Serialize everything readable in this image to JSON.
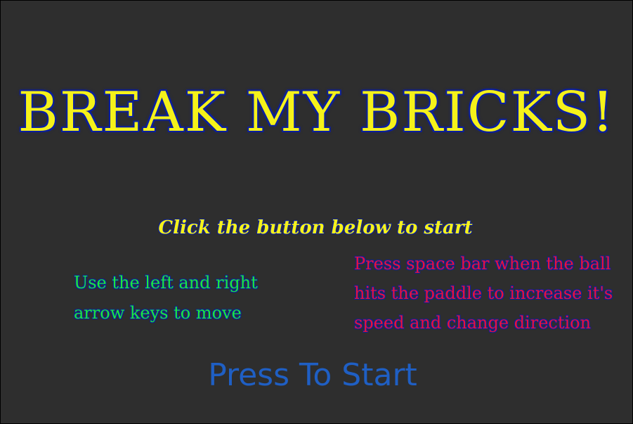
{
  "game": {
    "title": "Break My Bricks!",
    "subtitle": "Click the button below to start",
    "instructions_left": [
      "Use the left and right",
      "arrow keys to move"
    ],
    "instructions_right": [
      "Press space bar when the ball",
      "hits the paddle to increase it's",
      "speed and change direction"
    ],
    "start_button_label": "Press To Start"
  },
  "colors": {
    "background": "#2e2e2e",
    "title": "#f5f21a",
    "outline": "#0b1f9e",
    "left_text": "#1ee83a",
    "right_text": "#e8133a",
    "button_text": "#1f5fc4"
  }
}
